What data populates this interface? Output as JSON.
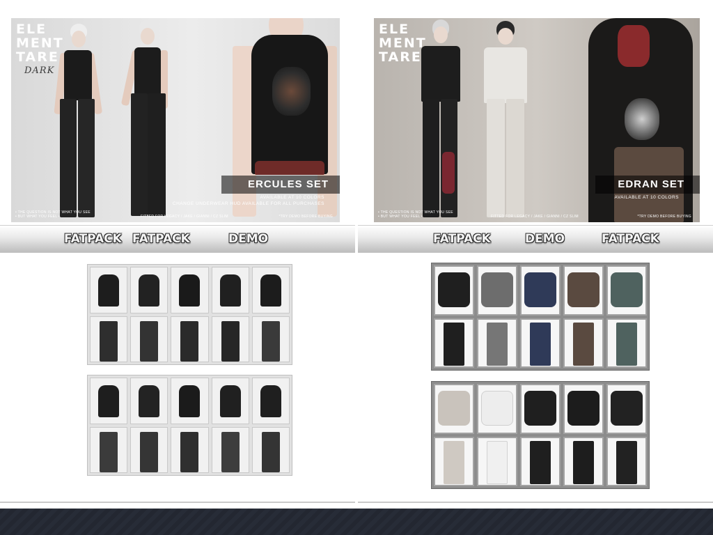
{
  "left_poster": {
    "logo": [
      "ELE",
      "MENT",
      "TARE"
    ],
    "logo_sub": "DARK",
    "set_title": "ERCULES SET",
    "lines": [
      "AVAILABLE AT 10 COLORS",
      "CHANGE UNDERWEAR HUD AVAILABLE FOR ALL PURCHASES"
    ],
    "fine_left": "• THE QUESTION IS NOT WHAT YOU SEE • BUT WHAT YOU FEEL •",
    "fine_mid": "FITTED FOR LEGACY / JAKE / GIANNI / CZ SLIM",
    "fine_right": "*TRY DEMO BEFORE BUYING"
  },
  "right_poster": {
    "logo": [
      "ELE",
      "MENT",
      "TARE"
    ],
    "set_title": "EDRAN SET",
    "lines": [
      "AVAILABLE AT 10 COLORS"
    ],
    "fine_left": "• THE QUESTION IS NOT WHAT YOU SEE • BUT WHAT YOU FEEL •",
    "fine_mid": "FITTED FOR LEGACY / JAKE / GIANNI / CZ SLIM",
    "fine_right": "*TRY DEMO BEFORE BUYING"
  },
  "left_strip": {
    "labels": [
      "FATPACK",
      "FATPACK",
      "DEMO"
    ]
  },
  "right_strip": {
    "labels": [
      "FATPACK",
      "DEMO",
      "FATPACK"
    ]
  },
  "colors": {
    "tank_black": "#1d1d1d",
    "pant_dark": "#2b2b2b",
    "shirt_black": "#1f1f1f",
    "shirt_grey": "#6d6d6d",
    "shirt_navy": "#2f3a58",
    "shirt_brown": "#5a4a40",
    "shirt_teal": "#4f625f",
    "shirt_beige": "#c9c3bc",
    "shirt_white": "#ededed"
  }
}
